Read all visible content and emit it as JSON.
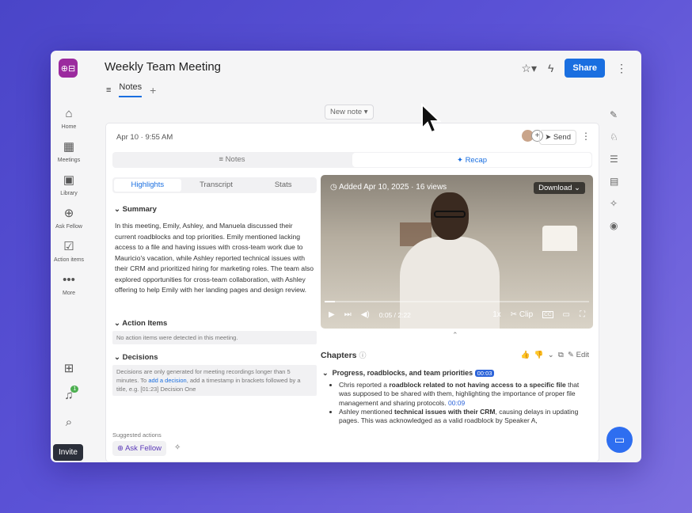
{
  "app": {
    "logo_glyph": "⊕⊟",
    "title": "Weekly Team Meeting",
    "share_label": "Share"
  },
  "tabs": [
    {
      "label": "Notes"
    }
  ],
  "left_nav": [
    {
      "label": "Home",
      "icon": "home-icon"
    },
    {
      "label": "Meetings",
      "icon": "calendar-icon"
    },
    {
      "label": "Library",
      "icon": "library-icon"
    },
    {
      "label": "Ask Fellow",
      "icon": "plus-circle-icon"
    },
    {
      "label": "Action items",
      "icon": "checkbox-icon"
    },
    {
      "label": "More",
      "icon": "more-icon"
    }
  ],
  "bottom_nav": {
    "notifications_count": "1",
    "invite_label": "Invite"
  },
  "new_note": {
    "label": "New note"
  },
  "meeting": {
    "date": "Apr 10",
    "time": "9:55 AM",
    "send_label": "Send"
  },
  "view_tabs": {
    "notes": "Notes",
    "recap": "Recap",
    "active": "Recap"
  },
  "recap_tabs": {
    "highlights": "Highlights",
    "transcript": "Transcript",
    "stats": "Stats",
    "active": "Highlights"
  },
  "summary": {
    "heading": "Summary",
    "text": "In this meeting, Emily, Ashley, and Manuela discussed their current roadblocks and top priorities. Emily mentioned lacking access to a file and having issues with cross-team work due to Mauricio's vacation, while Ashley reported technical issues with their CRM and prioritized hiring for marketing roles. The team also explored opportunities for cross-team collaboration, with Ashley offering to help Emily with her landing pages and design review."
  },
  "action_items": {
    "heading": "Action Items",
    "empty_text": "No action items were detected in this meeting."
  },
  "decisions": {
    "heading": "Decisions",
    "text_a": "Decisions are only generated for meeting recordings longer than 5 minutes. To ",
    "link": "add a decision",
    "text_b": ", add a timestamp in brackets followed by a title, e.g. [01:23] Decision One"
  },
  "suggested": {
    "label": "Suggested actions",
    "ask_fellow": "Ask Fellow"
  },
  "video": {
    "added": "Added Apr 10, 2025 · 16 views",
    "download_label": "Download",
    "time": "0:05 / 2:22",
    "speed": "1x",
    "clip_label": "Clip",
    "progress": 0.04
  },
  "chapters": {
    "heading": "Chapters",
    "edit_label": "Edit",
    "items": [
      {
        "title": "Progress, roadblocks, and team priorities",
        "timestamp": "00:03"
      }
    ]
  },
  "bullets": [
    {
      "a": "Chris reported a ",
      "b": "roadblock related to not having access to a specific file",
      "c": " that was supposed to be shared with them, highlighting the importance of proper file management and sharing protocols. ",
      "ts": "00:09"
    },
    {
      "a": "Ashley mentioned ",
      "b": "technical issues with their CRM",
      "c": ", causing delays in updating pages. This was acknowledged as a valid roadblock by Speaker A,",
      "ts": ""
    }
  ],
  "colors": {
    "accent": "#1a6fe0",
    "logo": "#9b2a9e",
    "background": "#5b52d6"
  }
}
